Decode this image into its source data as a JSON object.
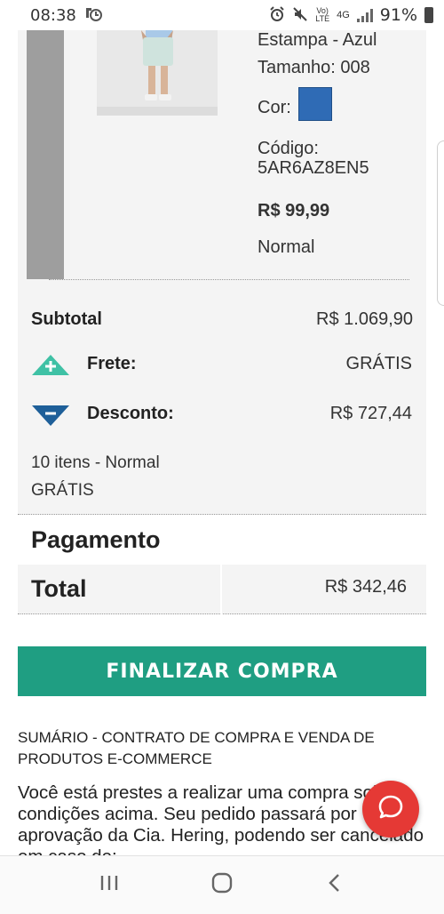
{
  "status_bar": {
    "time": "08:38",
    "network_label": "4G",
    "volte_label": "VoLTE",
    "battery": "91%"
  },
  "product": {
    "estampa": "Estampa - Azul",
    "tamanho": "Tamanho: 008",
    "cor_label": "Cor:",
    "cor_color": "#2f6bb5",
    "codigo_label": "Código:",
    "codigo_value": "5AR6AZ8EN5",
    "price": "R$ 99,99",
    "shipping_type": "Normal"
  },
  "summary": {
    "subtotal_label": "Subtotal",
    "subtotal_value": "R$ 1.069,90",
    "frete_label": "Frete:",
    "frete_value": "GRÁTIS",
    "desconto_label": "Desconto:",
    "desconto_value": "R$ 727,44",
    "items_text": "10 itens - Normal",
    "items_shipping": "GRÁTIS"
  },
  "payment": {
    "title": "Pagamento",
    "total_label": "Total",
    "total_value": "R$ 342,46"
  },
  "finalizar_button": "FINALIZAR COMPRA",
  "contract": {
    "title": "SUMÁRIO - CONTRATO DE COMPRA E VENDA DE PRODUTOS E-COMMERCE",
    "text": "Você está prestes a realizar uma compra sob as condições acima. Seu pedido passará por aprovação da Cia. Hering, podendo ser cancelado em caso de:"
  },
  "colors": {
    "accent": "#1f9e82",
    "chat": "#e53935",
    "swatch": "#2f6bb5"
  },
  "icons": {
    "frete": "triangle-up-plus-icon",
    "desconto": "triangle-down-minus-icon",
    "chat": "chat-bubble-icon"
  }
}
